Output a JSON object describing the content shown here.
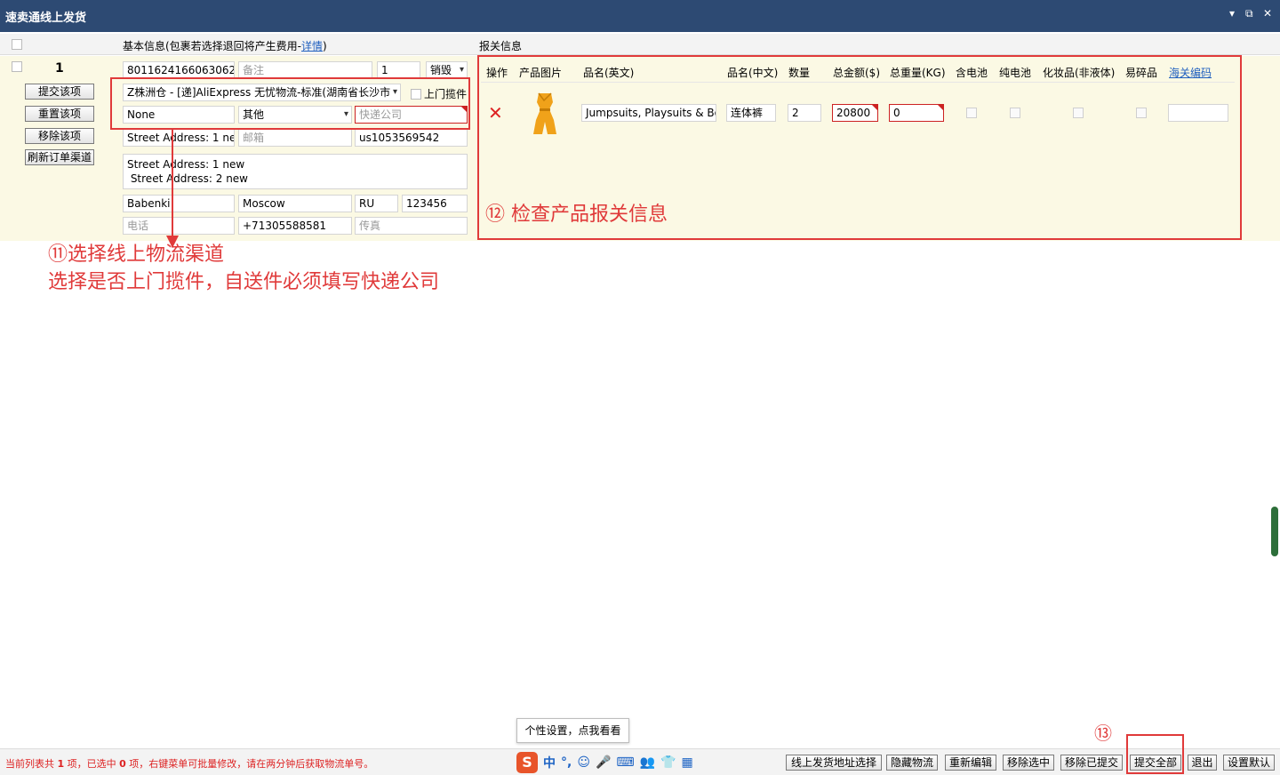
{
  "window": {
    "title": "速卖通线上发货",
    "controls": [
      "▾",
      "⧉",
      "✕"
    ]
  },
  "header": {
    "basic_label": "基本信息(包裹若选择退回将产生费用-",
    "basic_link": "详情",
    "basic_close": ")",
    "customs_label": "报关信息"
  },
  "order": {
    "row_number": "1",
    "side_buttons": [
      "提交该项",
      "重置该项",
      "移除该项",
      "刷新订单渠道"
    ],
    "order_id": "8011624166063062",
    "note_placeholder": "备注",
    "qty": "1",
    "sale_type": "销毁",
    "channel": "Z株洲仓 - [递]AliExpress 无忧物流-标准(湖南省长沙市",
    "pickup_label": "上门揽件",
    "none_value": "None",
    "other_value": "其他",
    "express_placeholder": "快递公司",
    "address1": "Street Address: 1 new",
    "postcode_placeholder": "邮箱",
    "buyer_id": "us1053569542",
    "address_full_line1": "Street Address: 1 new",
    "address_full_line2": " Street Address: 2 new",
    "city": "Babenki",
    "state": "Moscow",
    "country": "RU",
    "zip": "123456",
    "phone_placeholder": "电话",
    "mobile": "+71305588581",
    "fax_placeholder": "传真"
  },
  "customs": {
    "columns": [
      "操作",
      "产品图片",
      "品名(英文)",
      "品名(中文)",
      "数量",
      "总金额($)",
      "总重量(KG)",
      "含电池",
      "纯电池",
      "化妆品(非液体)",
      "易碎品",
      "海关编码"
    ],
    "row": {
      "name_en": "Jumpsuits, Playsuits & Bo",
      "name_cn": "连体裤",
      "qty": "2",
      "amount": "20800",
      "weight": "0",
      "hs_code": ""
    }
  },
  "annotations": {
    "a11_line1": "⑪选择线上物流渠道",
    "a11_line2": "选择是否上门揽件，自送件必须填写快递公司",
    "a12": "⑫ 检查产品报关信息",
    "a13": "⑬"
  },
  "tooltip": "个性设置，点我看看",
  "status": {
    "prefix": "当前列表共 ",
    "total": "1",
    "mid": " 项，已选中 ",
    "selected": "0",
    "suffix": " 项，右键菜单可批量修改，请在两分钟后获取物流单号。"
  },
  "ime": {
    "logo": "S",
    "icons": [
      "中",
      "°,",
      "☺",
      "🎤",
      "⌨",
      "👥",
      "👕",
      "▦"
    ]
  },
  "bottom_buttons": [
    "线上发货地址选择",
    "隐藏物流",
    "重新编辑",
    "移除选中",
    "移除已提交",
    "提交全部",
    "退出",
    "设置默认"
  ],
  "colors": {
    "titlebar": "#2d4a73",
    "order_bg": "#fbf9e4",
    "annotation": "#e03a3a",
    "link": "#1f5fbf"
  }
}
